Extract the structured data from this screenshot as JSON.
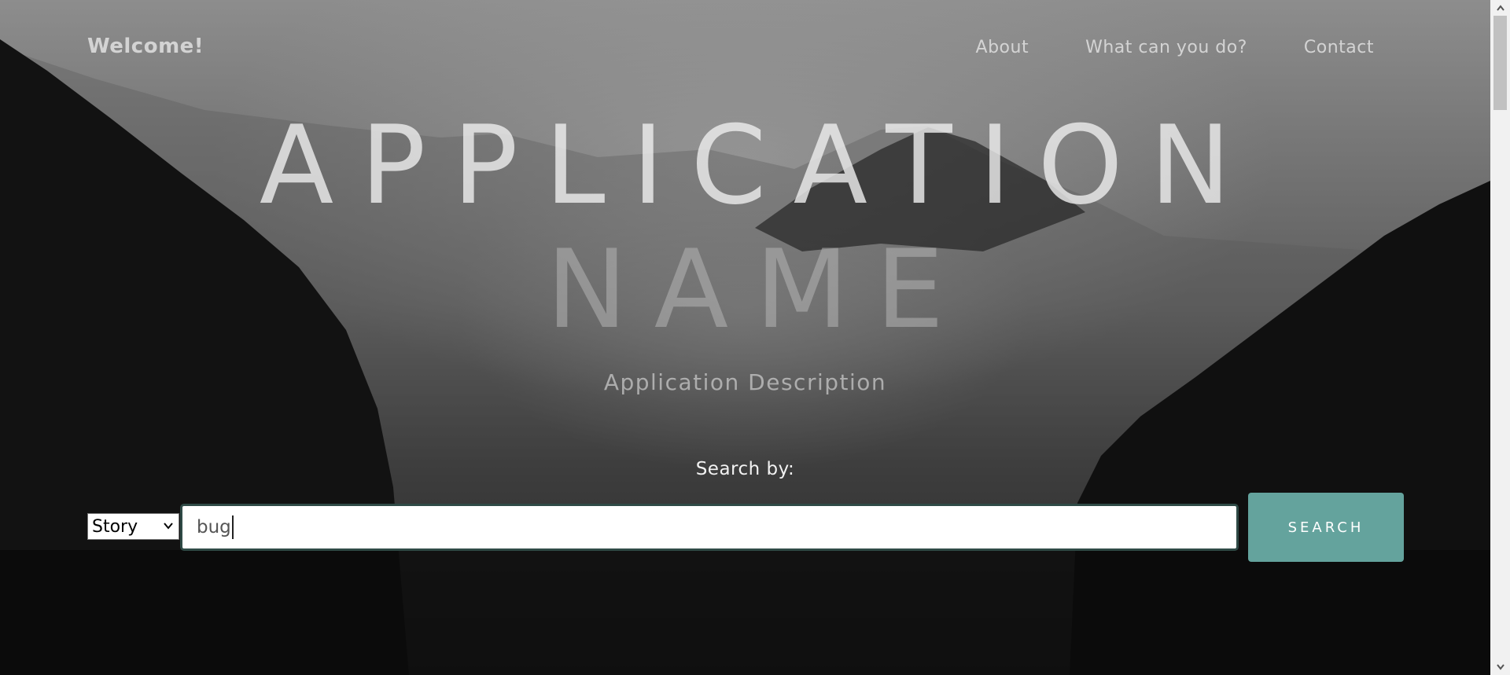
{
  "nav": {
    "brand": "Welcome!",
    "links": [
      "About",
      "What can you do?",
      "Contact"
    ]
  },
  "hero": {
    "title_line1": "APPLICATION",
    "title_line2": "NAME",
    "description": "Application Description"
  },
  "search": {
    "label": "Search by:",
    "select_value": "Story",
    "query": "bug",
    "button_label": "SEARCH"
  },
  "colors": {
    "button": "#64a39d",
    "input_border": "#2f4a46"
  },
  "icons": [
    "chevron-down-icon",
    "scroll-up-arrow-icon",
    "scroll-down-arrow-icon"
  ]
}
